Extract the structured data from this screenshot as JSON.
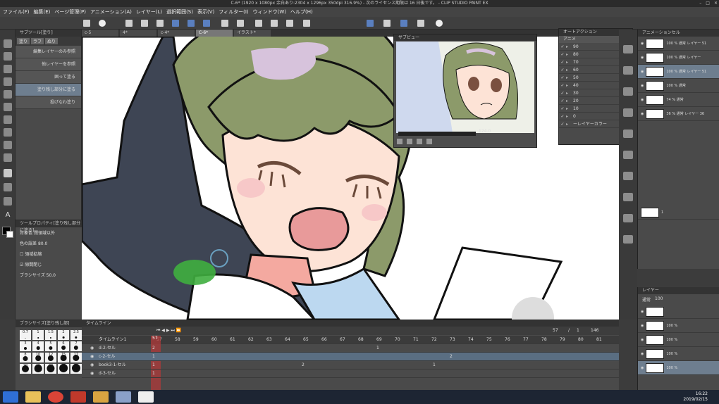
{
  "window": {
    "title": "C-6* (1920 x 1080px 余白あり:2304 x 1296px 350dpi 316.9%)  - 次のライセンス期限は 16 日後です。 - CLIP STUDIO PAINT EX"
  },
  "menu": {
    "items": [
      "ファイル(F)",
      "編集(E)",
      "ページ管理(P)",
      "アニメーション(A)",
      "レイヤー(L)",
      "選択範囲(S)",
      "表示(V)",
      "フィルター(I)",
      "ウィンドウ(W)",
      "ヘルプ(H)"
    ]
  },
  "tabs": [
    {
      "label": "c-5"
    },
    {
      "label": "4*"
    },
    {
      "label": "c-4*"
    },
    {
      "label": "C-6*"
    },
    {
      "label": "イラスト*"
    }
  ],
  "subtool": {
    "title": "サブツール[塗り]",
    "tabs": [
      "塗り",
      "ラフ",
      "ぬり"
    ],
    "items": [
      {
        "label": "編集レイヤーのみ参照"
      },
      {
        "label": "他レイヤーを参照"
      },
      {
        "label": "囲って塗る"
      },
      {
        "label": "塗り残し部分に塗る"
      },
      {
        "label": "投げなわ塗り"
      }
    ]
  },
  "toolprop": {
    "title": "ツールプロパティ[塗り残し部分に塗る]",
    "target_label": "対象色",
    "target_value": "閉領域以外",
    "tolerance_label": "色の誤差",
    "tolerance_value": "80.0",
    "expand_label": "領域拡縮",
    "close_gap_label": "隙間閉じ",
    "brush_size_label": "ブラシサイズ",
    "brush_size_value": "50.0"
  },
  "brushsize": {
    "title": "ブラシサイズ[塗り残し部]",
    "sizes": [
      "0.7",
      "1",
      "1.5",
      "2",
      "2.5",
      "3",
      "4",
      "5",
      "6",
      "7",
      "8",
      "10",
      "12",
      "15",
      "17",
      "20",
      "25",
      "30",
      "40",
      "50"
    ]
  },
  "subview": {
    "title": "サブビュー",
    "zoom": "124.0"
  },
  "autoaction": {
    "title": "オートアクション",
    "set": "アニメ",
    "items": [
      {
        "label": "90"
      },
      {
        "label": "80"
      },
      {
        "label": "70"
      },
      {
        "label": "60"
      },
      {
        "label": "50"
      },
      {
        "label": "40"
      },
      {
        "label": "30"
      },
      {
        "label": "20"
      },
      {
        "label": "10"
      },
      {
        "label": "0"
      },
      {
        "label": "ーレイヤーカラー"
      }
    ]
  },
  "animcels": {
    "title": "アニメーションセル",
    "items": [
      {
        "label": "100 % 通常 レイヤー 51"
      },
      {
        "label": "100 % 通常 レイヤー"
      },
      {
        "label": "100 % 通常 レイヤー 51"
      },
      {
        "label": "100 % 通常"
      },
      {
        "label": "74 % 通常"
      },
      {
        "label": "36 % 通常 レイヤー 36"
      }
    ],
    "bottom_label": "1"
  },
  "layers": {
    "title": "レイヤー",
    "blend": "通常",
    "opacity": "100",
    "rows": [
      {
        "label": ""
      },
      {
        "label": "100 %"
      },
      {
        "label": "100 %"
      },
      {
        "label": "100 %"
      },
      {
        "label": "100 %"
      }
    ]
  },
  "timeline": {
    "title": "タイムライン",
    "name": "タイムライン1",
    "current_frame": "57",
    "frame_info": "57",
    "frame_slash": "1",
    "total": "146",
    "frames": [
      "57",
      "58",
      "59",
      "60",
      "61",
      "62",
      "63",
      "64",
      "65",
      "66",
      "67",
      "68",
      "69",
      "70",
      "71",
      "72",
      "73",
      "74",
      "75",
      "76",
      "77",
      "78",
      "79",
      "80",
      "81"
    ],
    "tracks": [
      {
        "name": "d-2-セル",
        "marks": [
          {
            "frame": "2"
          },
          {
            "frame": "1"
          }
        ]
      },
      {
        "name": "c-2-セル",
        "marks": [
          {
            "frame": "1"
          },
          {
            "frame": "2"
          }
        ]
      },
      {
        "name": "book3-1-セル",
        "marks": [
          {
            "frame": "1"
          },
          {
            "frame": "2"
          },
          {
            "frame": "1"
          }
        ]
      },
      {
        "name": "d-3-セル",
        "marks": [
          {
            "frame": "1"
          }
        ]
      }
    ]
  },
  "taskbar": {
    "time": "16:22",
    "date": "2019/02/15"
  },
  "colors": {
    "chrome": "#3c3c3c",
    "panel": "#4a4a4a",
    "hair": "#8c9a6a",
    "skin": "#fde3d6",
    "mouth": "#e89a9a",
    "green_fill": "#3fae3f",
    "playhead": "#b03a3a"
  }
}
